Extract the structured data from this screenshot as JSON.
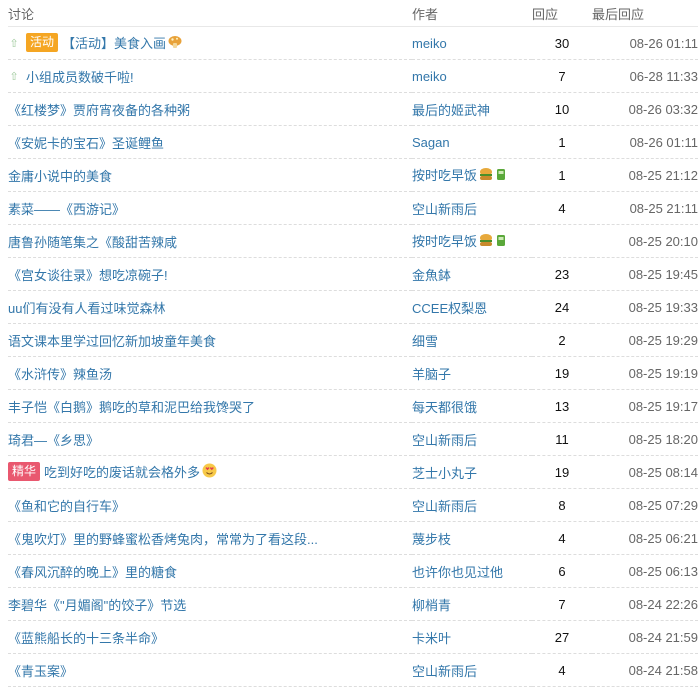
{
  "header": {
    "topic": "讨论",
    "author": "作者",
    "replies": "回应",
    "last_reply": "最后回应"
  },
  "rows": [
    {
      "pinned": true,
      "tag": "活动",
      "tag_color": "#f5a623",
      "title": "【活动】美食入画",
      "emoji": "mushroom-icon",
      "author": "meiko",
      "replies": "30",
      "time": "08-26 01:11"
    },
    {
      "pinned": true,
      "tag": "",
      "title": "小组成员数破千啦!",
      "author": "meiko",
      "replies": "7",
      "time": "06-28 11:33"
    },
    {
      "pinned": false,
      "tag": "",
      "title": "《红楼梦》贾府宵夜备的各种粥",
      "author": "最后的姬武神",
      "replies": "10",
      "time": "08-26 03:32"
    },
    {
      "pinned": false,
      "tag": "",
      "title": "《安妮卡的宝石》圣诞鲤鱼",
      "author": "Sagan",
      "replies": "1",
      "time": "08-26 01:11"
    },
    {
      "pinned": false,
      "tag": "",
      "title": "金庸小说中的美食",
      "author": "按时吃早饭",
      "author_emoji": true,
      "replies": "1",
      "time": "08-25 21:12"
    },
    {
      "pinned": false,
      "tag": "",
      "title": "素菜——《西游记》",
      "author": "空山新雨后",
      "replies": "4",
      "time": "08-25 21:11"
    },
    {
      "pinned": false,
      "tag": "",
      "title": "唐鲁孙随笔集之《酸甜苦辣咸",
      "author": "按时吃早饭",
      "author_emoji": true,
      "replies": "",
      "time": "08-25 20:10"
    },
    {
      "pinned": false,
      "tag": "",
      "title": "《宫女谈往录》想吃凉碗子!",
      "author": "金魚鉢",
      "replies": "23",
      "time": "08-25 19:45"
    },
    {
      "pinned": false,
      "tag": "",
      "title": "uu们有没有人看过味觉森林",
      "author": "CCEE权梨恩",
      "replies": "24",
      "time": "08-25 19:33"
    },
    {
      "pinned": false,
      "tag": "",
      "title": "语文课本里学过回忆新加坡童年美食",
      "author": "细雪",
      "replies": "2",
      "time": "08-25 19:29"
    },
    {
      "pinned": false,
      "tag": "",
      "title": "《水浒传》辣鱼汤",
      "author": "羊脑子",
      "replies": "19",
      "time": "08-25 19:19"
    },
    {
      "pinned": false,
      "tag": "",
      "title": "丰子恺《白鹅》鹅吃的草和泥巴给我馋哭了",
      "author": "每天都很饿",
      "replies": "13",
      "time": "08-25 19:17"
    },
    {
      "pinned": false,
      "tag": "",
      "title": "琦君—《乡思》",
      "author": "空山新雨后",
      "replies": "11",
      "time": "08-25 18:20"
    },
    {
      "pinned": false,
      "tag": "精华",
      "tag_color": "#e9586f",
      "title": "吃到好吃的废话就会格外多",
      "emoji": "smile-hearts-icon",
      "author": "芝士小丸子",
      "replies": "19",
      "time": "08-25 08:14"
    },
    {
      "pinned": false,
      "tag": "",
      "title": "《鱼和它的自行车》",
      "author": "空山新雨后",
      "replies": "8",
      "time": "08-25 07:29"
    },
    {
      "pinned": false,
      "tag": "",
      "title": "《鬼吹灯》里的野蜂蜜松香烤兔肉，常常为了看这段...",
      "author": "蔑步枝",
      "replies": "4",
      "time": "08-25 06:21"
    },
    {
      "pinned": false,
      "tag": "",
      "title": "《春风沉醉的晚上》里的糖食",
      "author": "也许你也见过他",
      "replies": "6",
      "time": "08-25 06:13"
    },
    {
      "pinned": false,
      "tag": "",
      "title": "李碧华《\"月媚阁\"的饺子》节选",
      "author": "柳梢青",
      "replies": "7",
      "time": "08-24 22:26"
    },
    {
      "pinned": false,
      "tag": "",
      "title": "《蓝熊船长的十三条半命》",
      "author": "卡米叶",
      "replies": "27",
      "time": "08-24 21:59"
    },
    {
      "pinned": false,
      "tag": "",
      "title": "《青玉案》",
      "author": "空山新雨后",
      "replies": "4",
      "time": "08-24 21:58"
    }
  ]
}
